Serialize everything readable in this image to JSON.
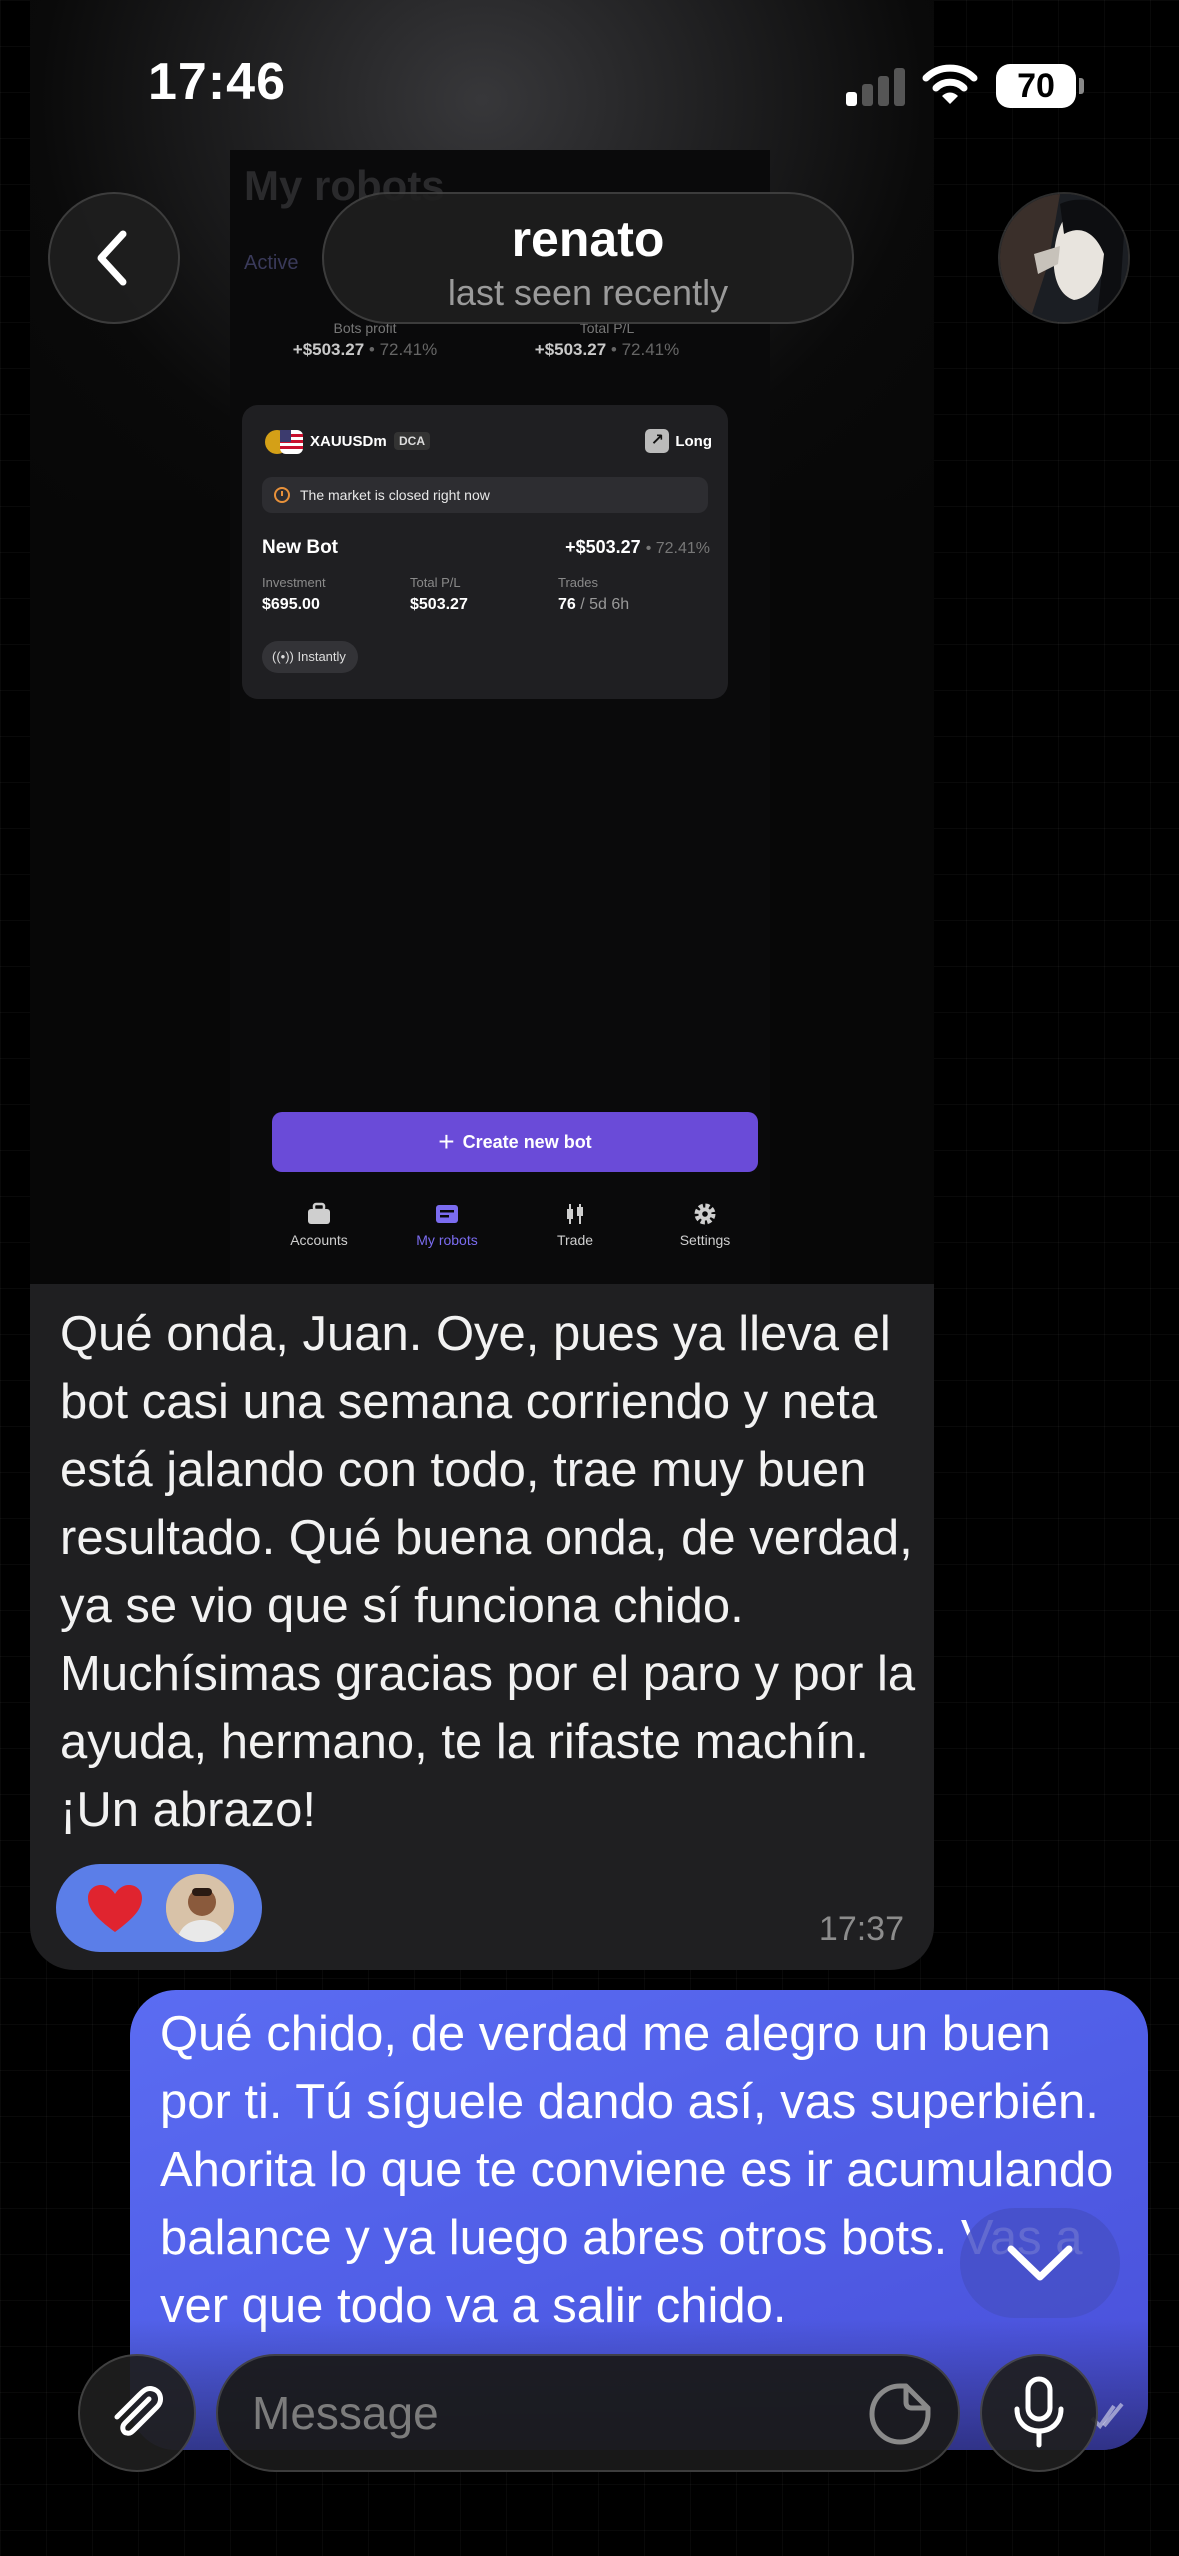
{
  "status_bar": {
    "time": "17:46",
    "battery": "70"
  },
  "header": {
    "contact_name": "renato",
    "contact_status": "last seen recently"
  },
  "screenshot": {
    "ghost_title": "My robots",
    "ghost_tab": "Active",
    "stats": [
      {
        "label": "Bots profit",
        "value": "+$503.27",
        "pct": "• 72.41%"
      },
      {
        "label": "Total P/L",
        "value": "+$503.27",
        "pct": "• 72.41%"
      }
    ],
    "bot_card": {
      "symbol": "XAUUSDm",
      "tag": "DCA",
      "direction": "Long",
      "notice": "The market is closed right now",
      "name": "New Bot",
      "pl": "+$503.27",
      "pl_pct": "• 72.41%",
      "investment_label": "Investment",
      "investment_value": "$695.00",
      "total_pl_label": "Total P/L",
      "total_pl_value": "$503.27",
      "trades_label": "Trades",
      "trades_value": "76",
      "trades_duration": "/ 5d 6h",
      "mode": "Instantly"
    },
    "create_button": "Create new bot",
    "tabs": [
      {
        "label": "Accounts",
        "icon": "briefcase-icon"
      },
      {
        "label": "My robots",
        "icon": "robot-card-icon",
        "active": true
      },
      {
        "label": "Trade",
        "icon": "candlestick-icon"
      },
      {
        "label": "Settings",
        "icon": "gear-icon"
      }
    ]
  },
  "incoming_message": {
    "text": "Qué onda, Juan. Oye, pues ya lleva el bot casi una semana corriendo y neta está jalando con todo, trae muy buen resultado. Qué buena onda, de verdad, ya se vio que sí funciona chido. Muchísimas gracias por el paro y por la ayuda, hermano, te la rifaste machín. ¡Un abrazo!",
    "time": "17:37",
    "reaction": "heart"
  },
  "outgoing_message": {
    "text": "Qué chido, de verdad me alegro un buen por ti. Tú síguele dando así, vas superbién. Ahorita lo que te conviene es ir acumulando balance y ya luego abres otros bots. Vas a ver que todo va a salir chido."
  },
  "composer": {
    "placeholder": "Message"
  },
  "colors": {
    "accent": "#5b6cf2",
    "bubble_in": "#1f1f21",
    "create_button": "#6a4bd8",
    "active_tab": "#7b6cf0"
  }
}
